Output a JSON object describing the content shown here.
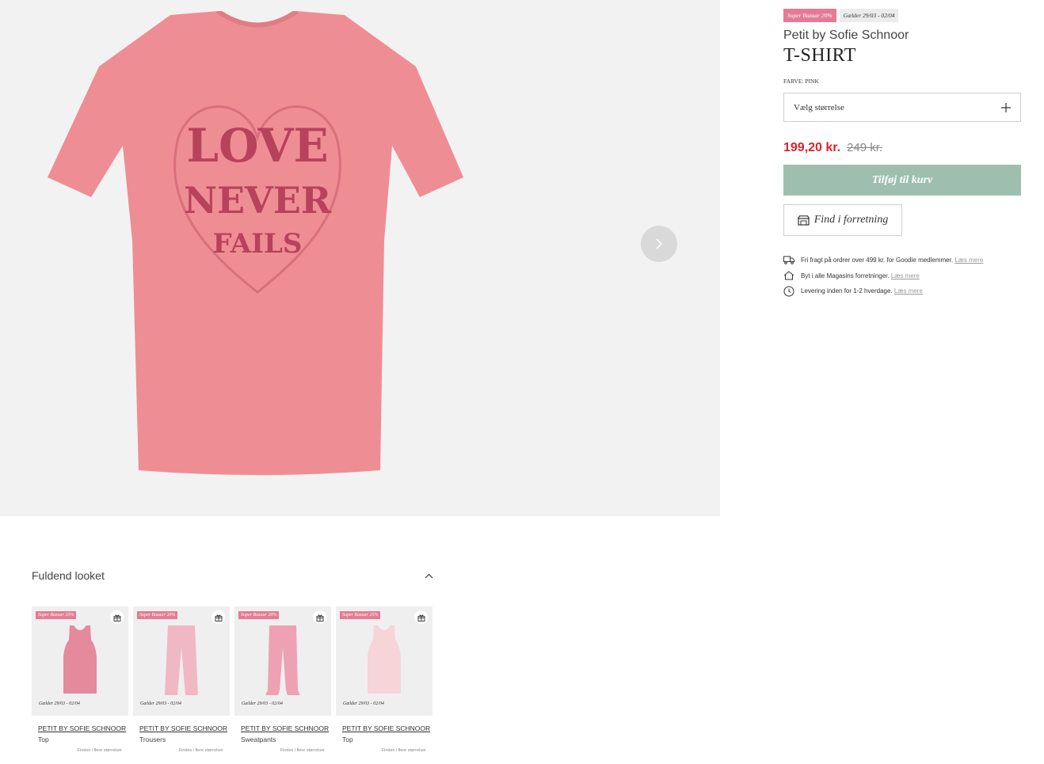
{
  "product": {
    "badge_sale": "Super Bazaar 20%",
    "badge_date": "Gælder 29/03 - 02/04",
    "brand": "Petit by Sofie Schnoor",
    "title": "T-SHIRT",
    "color_label": "FARVE:",
    "color_value": "PINK",
    "size_placeholder": "Vælg størrelse",
    "price_now": "199,20 kr.",
    "price_old": "249 kr.",
    "add_to_cart": "Tilføj til kurv",
    "find_in_store": "Find i forretning",
    "print_text": [
      "LOVE",
      "NEVER",
      "FAILS"
    ]
  },
  "usps": [
    {
      "icon": "truck-icon",
      "text": "Fri fragt på ordrer over 499 kr. for Goodie medlemmer.",
      "link": "Læs mere"
    },
    {
      "icon": "house-icon",
      "text": "Byt i alle Magasins forretninger.",
      "link": "Læs mere"
    },
    {
      "icon": "clock-icon",
      "text": "Levering inden for 1-2 hverdage.",
      "link": "Læs mere"
    }
  ],
  "look": {
    "title": "Fuldend looket",
    "items": [
      {
        "badge": "Super Bazaar 20%",
        "date": "Gælder 29/03 - 02/04",
        "brand": "PETIT BY SOFIE SCHNOOR",
        "type": "Top",
        "availability": "Findes i flere størrelser",
        "color": "#e48a9c"
      },
      {
        "badge": "Super Bazaar 20%",
        "date": "Gælder 29/03 - 02/04",
        "brand": "PETIT BY SOFIE SCHNOOR",
        "type": "Trousers",
        "availability": "Findes i flere størrelser",
        "color": "#f0b8c4"
      },
      {
        "badge": "Super Bazaar 20%",
        "date": "Gælder 29/03 - 02/04",
        "brand": "PETIT BY SOFIE SCHNOOR",
        "type": "Sweatpants",
        "availability": "Findes i flere størrelser",
        "color": "#eea1b2"
      },
      {
        "badge": "Super Bazaar 20%",
        "date": "Gælder 29/03 - 02/04",
        "brand": "PETIT BY SOFIE SCHNOOR",
        "type": "Top",
        "availability": "Findes i flere størrelser",
        "color": "#f6d4d8"
      }
    ]
  },
  "colors": {
    "sale": "#e57b93",
    "price": "#d6252b",
    "cart": "#9ebfb0",
    "shirt": "#ef8d94",
    "print": "#b03a55"
  }
}
